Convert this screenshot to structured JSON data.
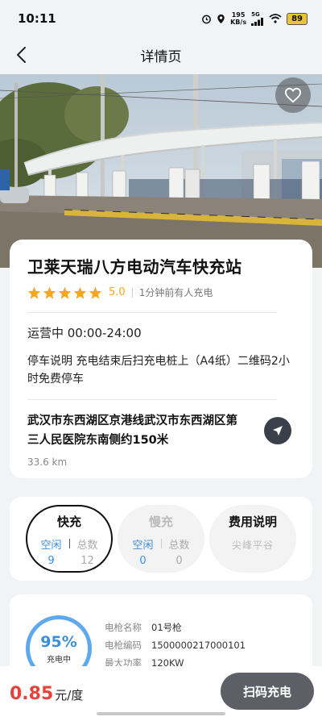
{
  "status_bar": {
    "time": "10:11",
    "net_speed_value": "195",
    "net_speed_unit": "KB/s",
    "network": "5G",
    "battery": "89"
  },
  "nav": {
    "title": "详情页"
  },
  "station": {
    "name": "卫莱天瑞八方电动汽车快充站",
    "rating": "5.0",
    "rating_stars": 5,
    "recent_activity": "1分钟前有人充电",
    "hours": "运营中  00:00-24:00",
    "parking": "停车说明 充电结束后扫充电桩上（A4纸）二维码2小时免费停车",
    "address": "武汉市东西湖区京港线武汉市东西湖区第三人民医院东南侧约150米",
    "distance": "33.6 km"
  },
  "tabs": [
    {
      "title": "快充",
      "free_label": "空闲",
      "total_label": "总数",
      "free": "9",
      "total": "12"
    },
    {
      "title": "慢充",
      "free_label": "空闲",
      "total_label": "总数",
      "free": "0",
      "total": "0"
    },
    {
      "title": "费用说明",
      "note": "尖峰平谷"
    }
  ],
  "gun": {
    "percent": "95%",
    "percent_value": 0.95,
    "state": "充电中",
    "rows": [
      {
        "key": "电枪名称",
        "value": "01号枪"
      },
      {
        "key": "电枪编码",
        "value": "1500000217000101"
      },
      {
        "key": "最大功率",
        "value": "120KW"
      }
    ]
  },
  "bottom": {
    "price": "0.85",
    "price_unit": "元/度",
    "scan_button": "扫码充电"
  },
  "colors": {
    "accent_blue": "#3b8fd9",
    "price_red": "#e8413a",
    "star_orange": "#f5a623",
    "button_gray": "#5c5f66"
  }
}
